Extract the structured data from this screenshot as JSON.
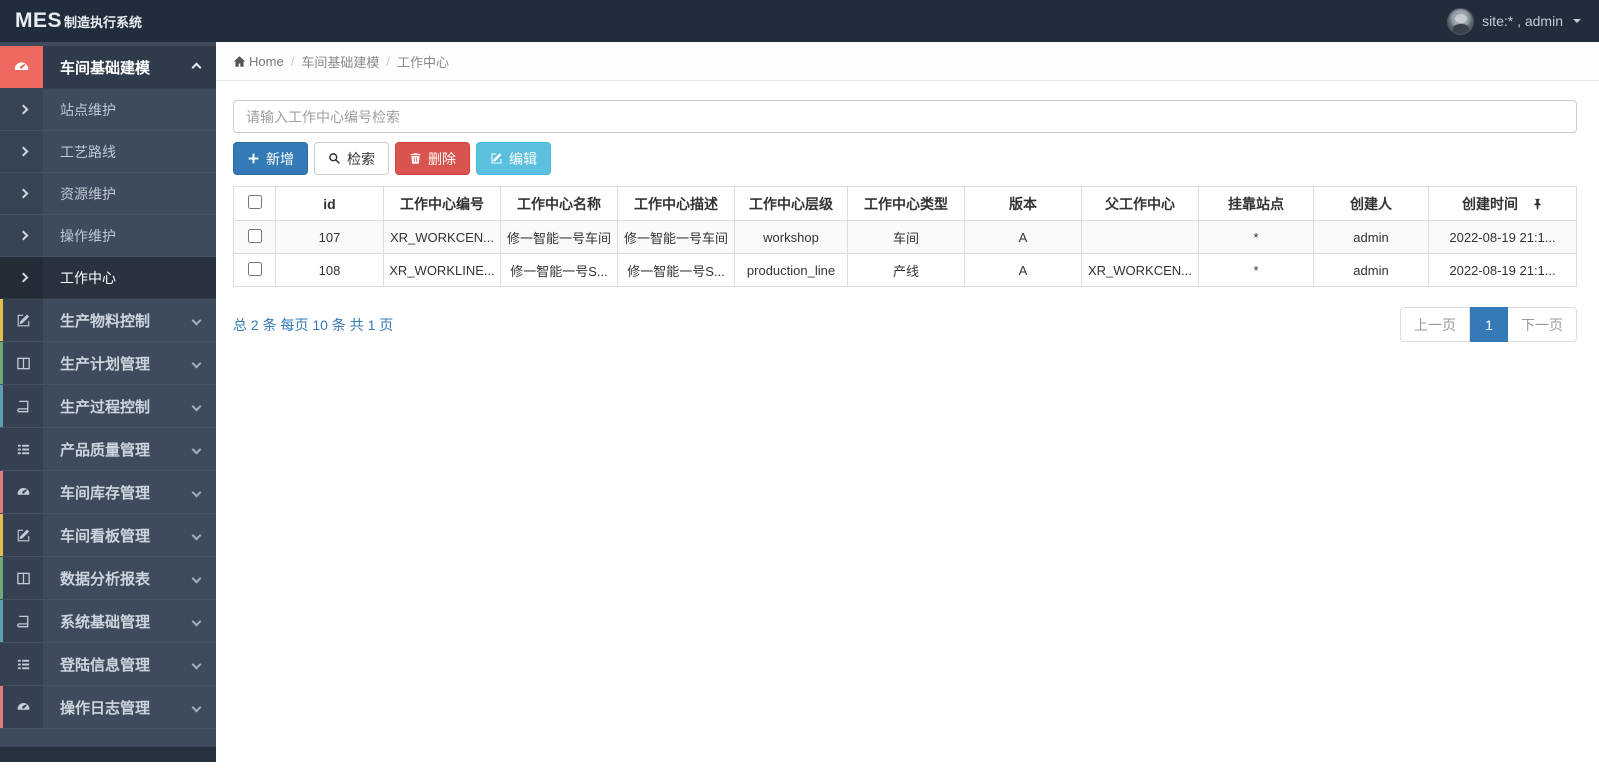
{
  "navbar": {
    "brand_bold": "MES",
    "brand_rest": "制造执行系统",
    "user_label": "site:* , admin"
  },
  "breadcrumb": {
    "home": "Home",
    "level1": "车间基础建模",
    "level2": "工作中心"
  },
  "sidebar": {
    "parent": {
      "label": "车间基础建模",
      "icon": "gauge-icon",
      "icon_bg": "#ee6a5f"
    },
    "submenu": [
      {
        "label": "站点维护"
      },
      {
        "label": "工艺路线"
      },
      {
        "label": "资源维护"
      },
      {
        "label": "操作维护"
      },
      {
        "label": "工作中心",
        "active": true
      }
    ],
    "items": [
      {
        "label": "生产物料控制",
        "icon": "pencil-square-icon",
        "stripe": "#e6bd4f"
      },
      {
        "label": "生产计划管理",
        "icon": "columns-icon",
        "stripe": "#6fa878"
      },
      {
        "label": "生产过程控制",
        "icon": "book-icon",
        "stripe": "#5e9db4"
      },
      {
        "label": "产品质量管理",
        "icon": "list-icon",
        "stripe": "transparent"
      },
      {
        "label": "车间库存管理",
        "icon": "gauge-icon",
        "stripe": "#e07b86"
      },
      {
        "label": "车间看板管理",
        "icon": "pencil-square-icon",
        "stripe": "#e6bd4f"
      },
      {
        "label": "数据分析报表",
        "icon": "columns-icon",
        "stripe": "#6fa878"
      },
      {
        "label": "系统基础管理",
        "icon": "book-icon",
        "stripe": "#5e9db4"
      },
      {
        "label": "登陆信息管理",
        "icon": "list-icon",
        "stripe": "transparent"
      },
      {
        "label": "操作日志管理",
        "icon": "gauge-icon",
        "stripe": "#e07b86"
      }
    ]
  },
  "toolbar": {
    "search_placeholder": "请输入工作中心编号检索",
    "add_label": "新增",
    "search_label": "检索",
    "delete_label": "删除",
    "edit_label": "编辑",
    "colors": {
      "primary": "#337ab7",
      "danger": "#d9534f",
      "info": "#5bc0de"
    }
  },
  "table": {
    "columns": [
      "id",
      "工作中心编号",
      "工作中心名称",
      "工作中心描述",
      "工作中心层级",
      "工作中心类型",
      "版本",
      "父工作中心",
      "挂靠站点",
      "创建人",
      "创建时间"
    ],
    "rows": [
      {
        "cells": [
          "107",
          "XR_WORKCEN...",
          "修一智能一号车间",
          "修一智能一号车间",
          "workshop",
          "车间",
          "A",
          "",
          "*",
          "admin",
          "2022-08-19 21:1..."
        ]
      },
      {
        "cells": [
          "108",
          "XR_WORKLINE...",
          "修一智能一号S...",
          "修一智能一号S...",
          "production_line",
          "产线",
          "A",
          "XR_WORKCEN...",
          "*",
          "admin",
          "2022-08-19 21:1..."
        ]
      }
    ]
  },
  "pagination": {
    "summary": "总 2 条 每页 10 条 共 1 页",
    "prev": "上一页",
    "current": "1",
    "next": "下一页"
  }
}
